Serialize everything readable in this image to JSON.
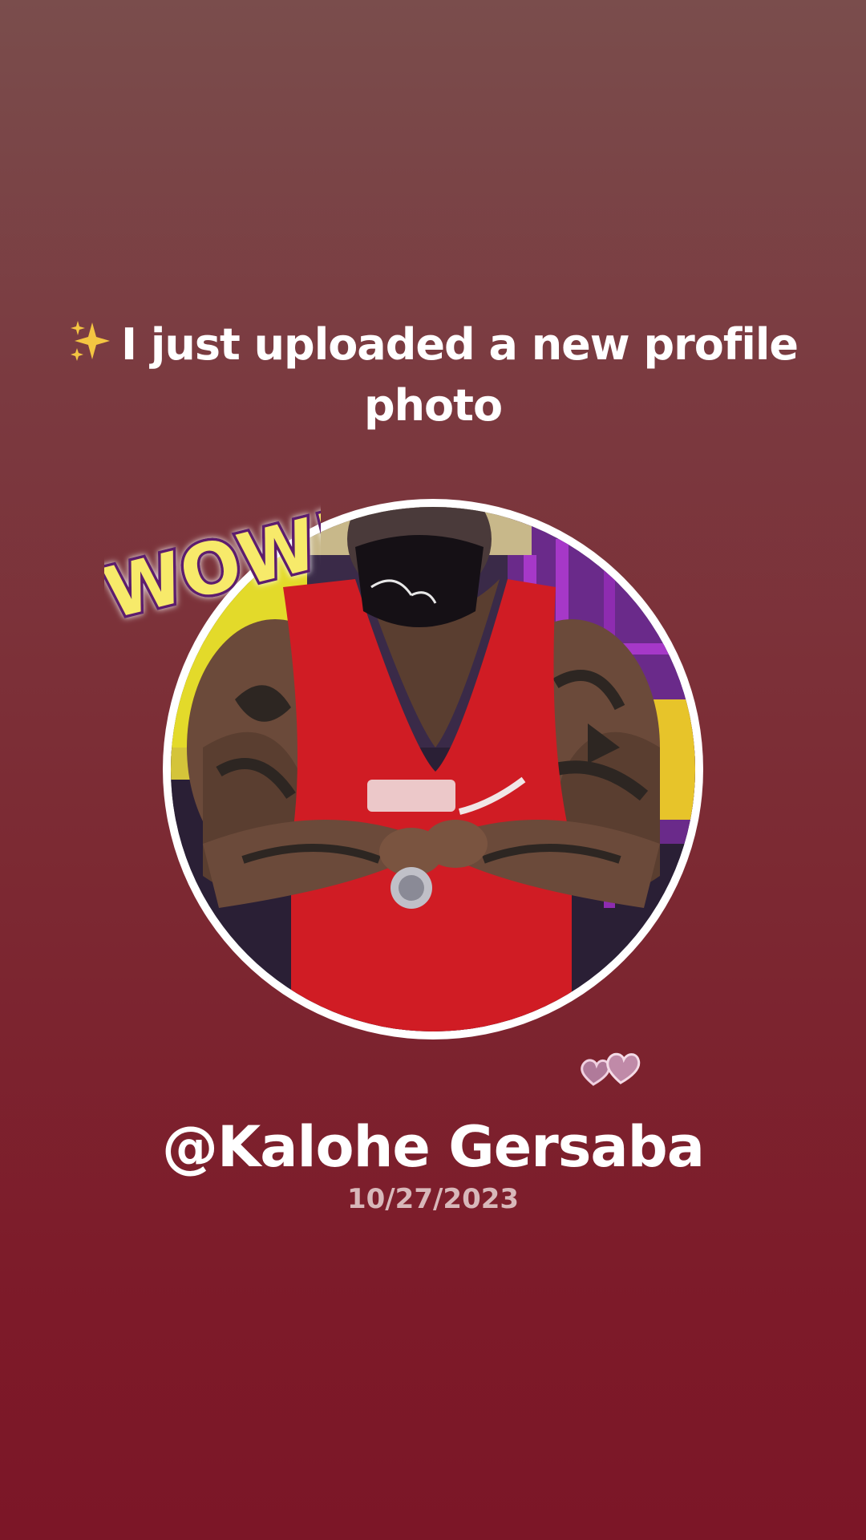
{
  "post": {
    "headline": "I just uploaded a new profile photo",
    "sticker_text": "WOW!",
    "username": "@Kalohe Gersaba",
    "date": "10/27/2023"
  },
  "icons": {
    "sparkle": "sparkles-icon",
    "hearts": "hearts-icon"
  },
  "colors": {
    "background_top": "#7a4d4c",
    "background_bottom": "#7c1627",
    "sticker_yellow": "#f7ea6a",
    "sticker_purple": "#5d1f6e"
  }
}
